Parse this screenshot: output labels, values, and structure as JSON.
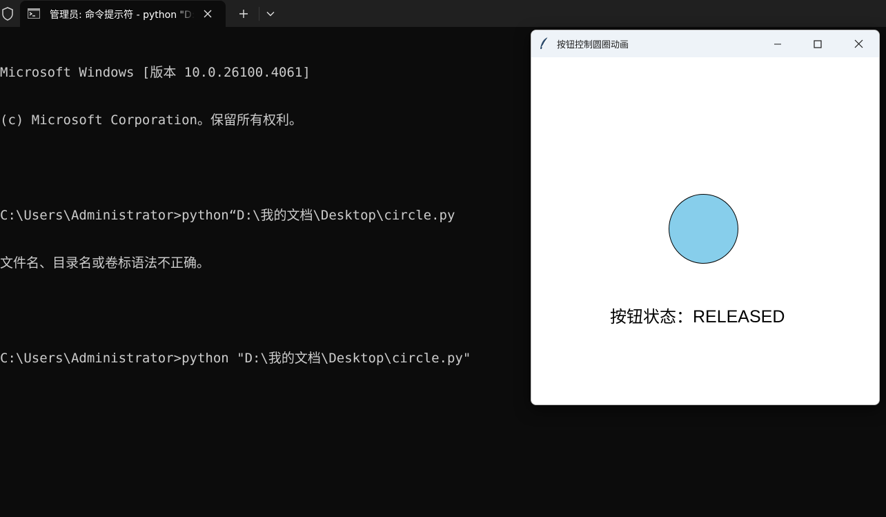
{
  "terminal": {
    "tab_title": "管理员: 命令提示符 - python \"D:\\我的文档\\Desktop\\circle.py\"",
    "console_lines": [
      "Microsoft Windows [版本 10.0.26100.4061]",
      "(c) Microsoft Corporation。保留所有权利。",
      "",
      "C:\\Users\\Administrator>python“D:\\我的文档\\Desktop\\circle.py",
      "文件名、目录名或卷标语法不正确。",
      "",
      "C:\\Users\\Administrator>python \"D:\\我的文档\\Desktop\\circle.py\""
    ],
    "colors": {
      "background": "#0c0c0c",
      "text": "#cccccc",
      "tabbar": "#202020"
    }
  },
  "tk_window": {
    "title": "按钮控制圆圈动画",
    "status_label": "按钮状态：",
    "status_value": "RELEASED",
    "circle_color": "#87ceeb",
    "icons": {
      "app": "feather-icon",
      "minimize": "minimize-icon",
      "maximize": "maximize-icon",
      "close": "close-icon"
    }
  },
  "tabbar_icons": [
    "shield-icon",
    "terminal-icon",
    "close-icon",
    "plus-icon",
    "chevron-down-icon"
  ]
}
